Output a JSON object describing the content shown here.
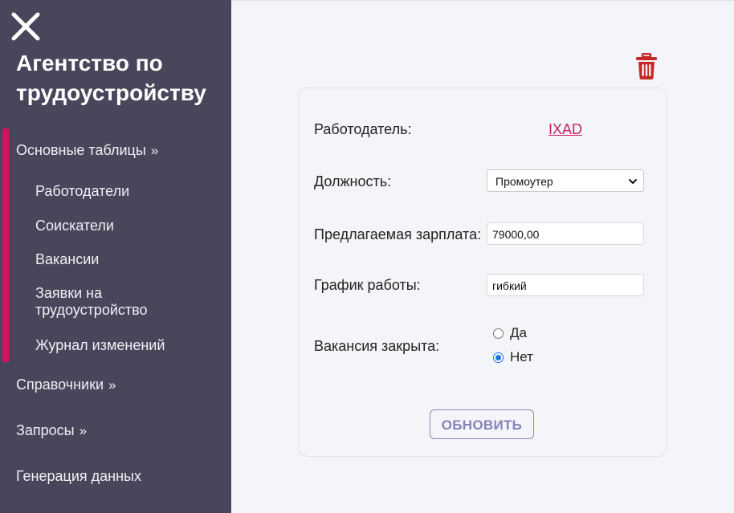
{
  "sidebar": {
    "brand_line1": "Агентство по",
    "brand_line2": "трудоустройству",
    "groups": [
      {
        "label": "Основные таблицы",
        "arrow": "»"
      },
      {
        "label": "Справочники",
        "arrow": "»"
      },
      {
        "label": "Запросы",
        "arrow": "»"
      },
      {
        "label": "Генерация данных"
      }
    ],
    "sub_items": [
      {
        "label": "Работодатели"
      },
      {
        "label": "Соискатели"
      },
      {
        "label": "Вакансии"
      },
      {
        "label": "Заявки на трудоустройство"
      },
      {
        "label": "Журнал изменений"
      }
    ]
  },
  "form": {
    "employer_label": "Работодатель:",
    "employer_value": "IXAD",
    "position_label": "Должность:",
    "position_value": "Промоутер",
    "salary_label": "Предлагаемая зарплата:",
    "salary_value": "79000,00",
    "schedule_label": "График работы:",
    "schedule_value": "гибкий",
    "closed_label": "Вакансия закрыта:",
    "closed_options": [
      {
        "label": "Да",
        "checked": false
      },
      {
        "label": "Нет",
        "checked": true
      }
    ],
    "update_button": "ОБНОВИТЬ"
  },
  "icons": {
    "close": "close-icon",
    "delete": "trash-icon",
    "select_chevron": "chevron-down-icon"
  },
  "colors": {
    "sidebar_bg": "#47465a",
    "accent": "#d4135f",
    "link": "#c4206a",
    "delete_icon": "#c62828",
    "button": "#8582b9",
    "radio_checked": "#1a73e8"
  }
}
